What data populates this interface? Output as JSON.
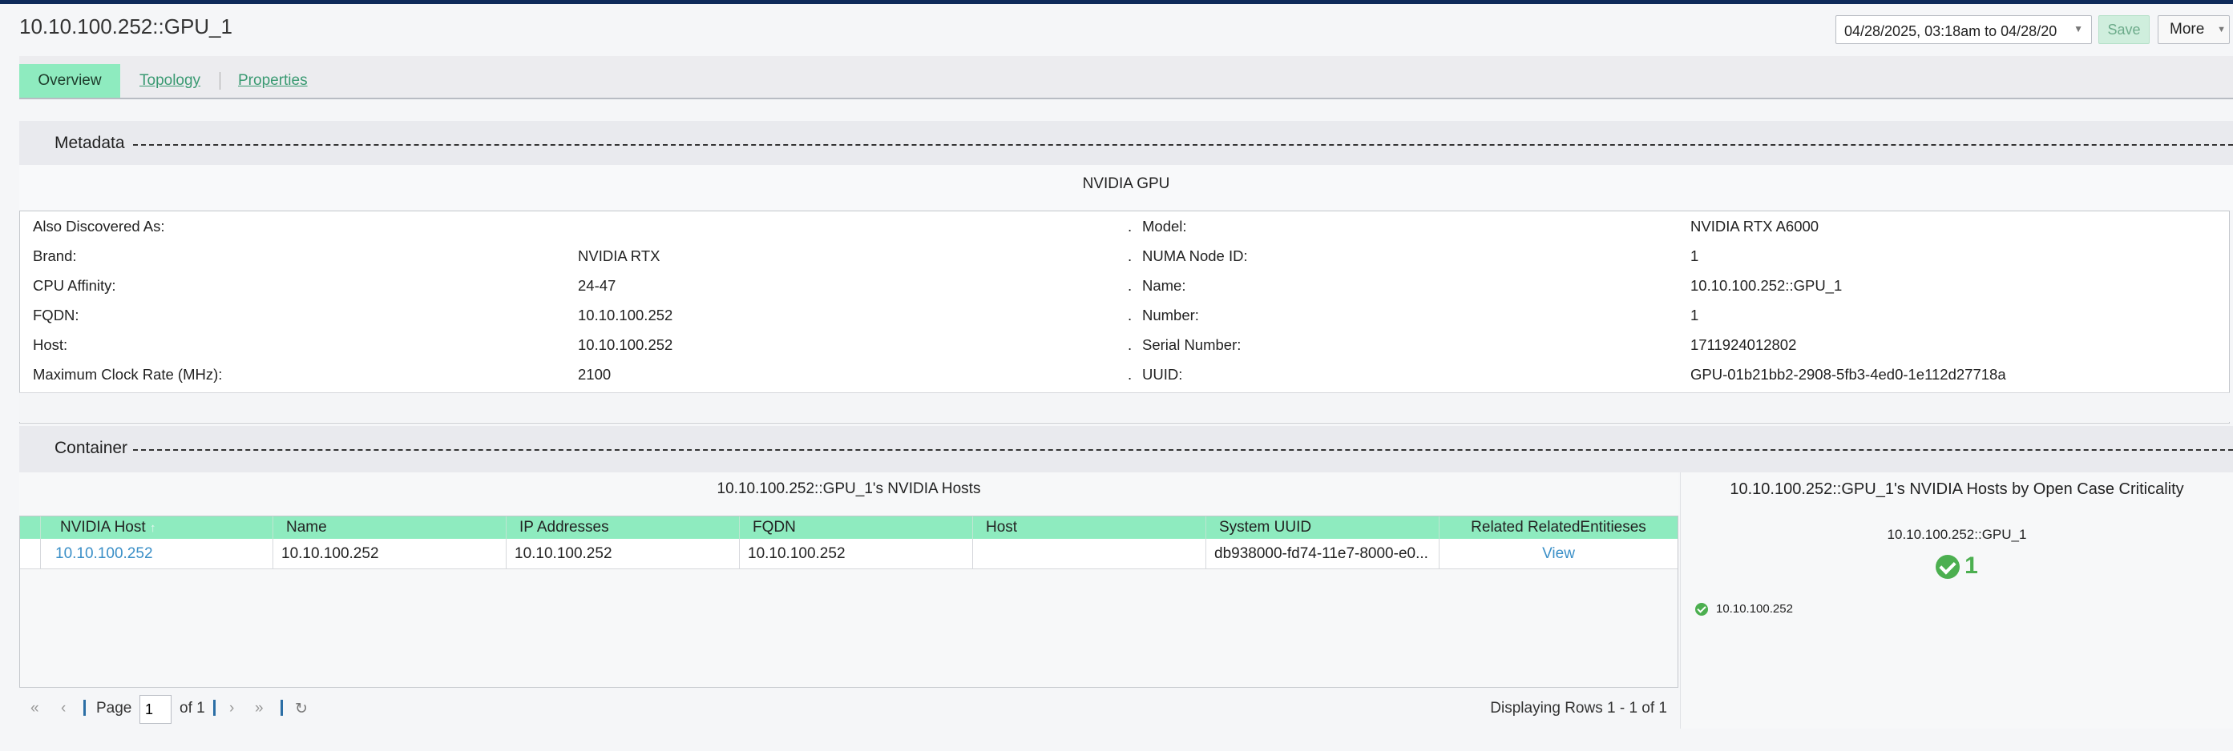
{
  "page": {
    "title": "10.10.100.252::GPU_1"
  },
  "toolbar": {
    "date_range": "04/28/2025, 03:18am to 04/28/20",
    "save_label": "Save",
    "more_label": "More"
  },
  "tabs": [
    {
      "label": "Overview",
      "active": true
    },
    {
      "label": "Topology",
      "active": false
    },
    {
      "label": "Properties",
      "active": false
    }
  ],
  "metadata": {
    "section_label": "Metadata",
    "title": "NVIDIA GPU",
    "rows": [
      {
        "l1": "Also Discovered As:",
        "v1": "",
        "dot": ".",
        "l2": "Model:",
        "v2": "NVIDIA RTX A6000"
      },
      {
        "l1": "Brand:",
        "v1": "NVIDIA RTX",
        "dot": ".",
        "l2": "NUMA Node ID:",
        "v2": "1"
      },
      {
        "l1": "CPU Affinity:",
        "v1": "24-47",
        "dot": ".",
        "l2": "Name:",
        "v2": "10.10.100.252::GPU_1"
      },
      {
        "l1": "FQDN:",
        "v1": "10.10.100.252",
        "dot": ".",
        "l2": "Number:",
        "v2": "1"
      },
      {
        "l1": "Host:",
        "v1": "10.10.100.252",
        "dot": ".",
        "l2": "Serial Number:",
        "v2": "1711924012802"
      },
      {
        "l1": "Maximum Clock Rate (MHz):",
        "v1": "2100",
        "dot": ".",
        "l2": "UUID:",
        "v2": "GPU-01b21bb2-2908-5fb3-4ed0-1e112d27718a"
      }
    ]
  },
  "container": {
    "section_label": "Container",
    "hosts_title": "10.10.100.252::GPU_1's NVIDIA Hosts",
    "columns": [
      "NVIDIA Host",
      "Name",
      "IP Addresses",
      "FQDN",
      "Host",
      "System UUID",
      "Related RelatedEntitieses"
    ],
    "sort_indicator": "↑",
    "rows": [
      {
        "nvidia_host": "10.10.100.252",
        "name": "10.10.100.252",
        "ip": "10.10.100.252",
        "fqdn": "10.10.100.252",
        "host": "",
        "uuid": "db938000-fd74-11e7-8000-e0...",
        "related": "View"
      }
    ],
    "pager": {
      "page_label": "Page",
      "page_value": "1",
      "of_label": "of 1",
      "displaying": "Displaying Rows 1 - 1 of 1"
    }
  },
  "criticality": {
    "title": "10.10.100.252::GPU_1's NVIDIA Hosts by Open Case Criticality",
    "node": "10.10.100.252::GPU_1",
    "count": "1",
    "items": [
      "10.10.100.252"
    ],
    "ok_color": "#4caf50"
  },
  "colors": {
    "accent": "#8eebbf",
    "link": "#3a8fc7",
    "topbar": "#0e2a5a"
  }
}
